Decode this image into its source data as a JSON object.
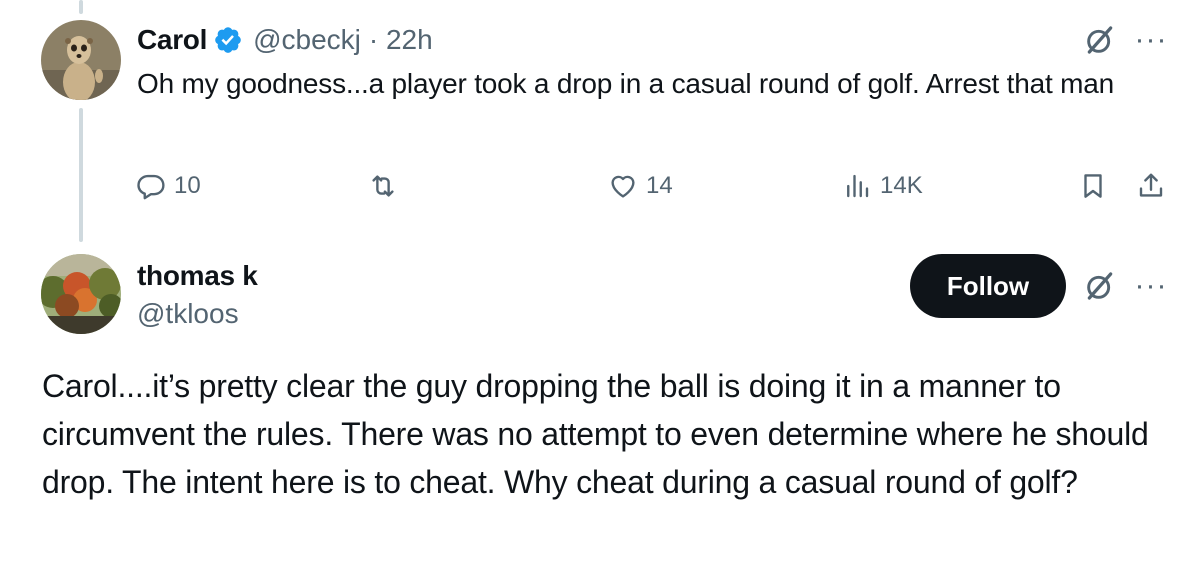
{
  "first_tweet": {
    "author": {
      "name": "Carol",
      "handle": "@cbeckj",
      "time": "· 22h",
      "verified": true,
      "avatar": "meerkat-photo"
    },
    "text": "Oh my goodness...a player took a drop in a casual round of golf. Arrest that man",
    "stats": {
      "replies": "10",
      "reposts": "",
      "likes": "14",
      "views": "14K"
    },
    "icons": {
      "reply": "reply-icon",
      "repost": "repost-icon",
      "like": "heart-icon",
      "views": "analytics-icon",
      "bookmark": "bookmark-icon",
      "share": "share-icon",
      "grok": "grok-icon",
      "more": "more-icon"
    },
    "more_glyph": "···"
  },
  "reply_tweet": {
    "author": {
      "name": "thomas k",
      "handle": "@tkloos",
      "avatar": "autumn-trees-photo"
    },
    "follow_label": "Follow",
    "more_glyph": "···",
    "text": "Carol....it’s pretty clear the guy dropping the ball is doing it in a manner to circumvent the rules.  There was no attempt to even determine where he should drop.  The intent here is to cheat.  Why cheat during a casual round of golf?"
  },
  "colors": {
    "text_primary": "#0f1419",
    "text_secondary": "#536471",
    "verified_blue": "#1d9bf0",
    "follow_bg": "#0f1419",
    "thread_line": "#cfd9de"
  }
}
